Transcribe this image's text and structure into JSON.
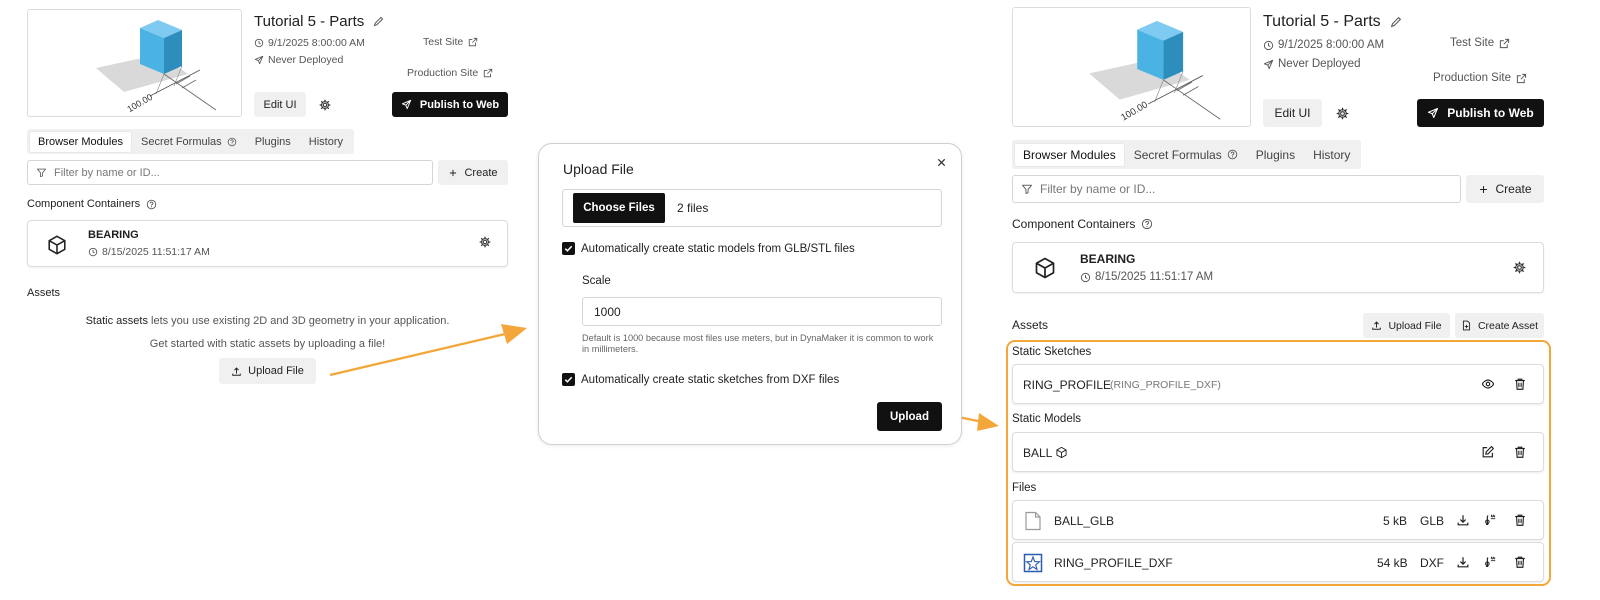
{
  "project": {
    "title": "Tutorial 5 - Parts",
    "date": "9/1/2025 8:00:00 AM",
    "deploy_status": "Never Deployed",
    "test_site": "Test Site",
    "production_site": "Production Site",
    "edit_ui": "Edit UI",
    "publish": "Publish to Web",
    "thumbnail_dimension": "100.00"
  },
  "tabs": [
    "Browser Modules",
    "Secret Formulas",
    "Plugins",
    "History"
  ],
  "filter": {
    "placeholder": "Filter by name or ID...",
    "create": "Create"
  },
  "component_containers": {
    "label": "Component Containers",
    "items": [
      {
        "name": "BEARING",
        "date": "8/15/2025 11:51:17 AM"
      }
    ]
  },
  "assets_empty": {
    "label": "Assets",
    "line1_link": "Static assets",
    "line1_rest": " lets you use existing 2D and 3D geometry in your application.",
    "line2": "Get started with static assets by uploading a file!",
    "upload_button": "Upload File"
  },
  "modal": {
    "title": "Upload File",
    "choose_files": "Choose Files",
    "files_selected": "2 files",
    "option_models": "Automatically create static models from GLB/STL files",
    "scale_label": "Scale",
    "scale_value": "1000",
    "scale_help": "Default is 1000 because most files use meters, but in DynaMaker it is common to work in millimeters.",
    "option_sketches": "Automatically create static sketches from DXF files",
    "upload": "Upload"
  },
  "assets_full": {
    "label": "Assets",
    "upload_file": "Upload File",
    "create_asset": "Create Asset",
    "static_sketches_label": "Static Sketches",
    "sketches": [
      {
        "name": "RING_PROFILE",
        "source": "(RING_PROFILE_DXF)"
      }
    ],
    "static_models_label": "Static Models",
    "models": [
      {
        "name": "BALL"
      }
    ],
    "files_label": "Files",
    "files": [
      {
        "name": "BALL_GLB",
        "size": "5 kB",
        "type": "GLB"
      },
      {
        "name": "RING_PROFILE_DXF",
        "size": "54 kB",
        "type": "DXF"
      }
    ]
  },
  "colors": {
    "accent": "#f3a73b",
    "cube": "#4ab3e3",
    "dark": "#111111"
  }
}
